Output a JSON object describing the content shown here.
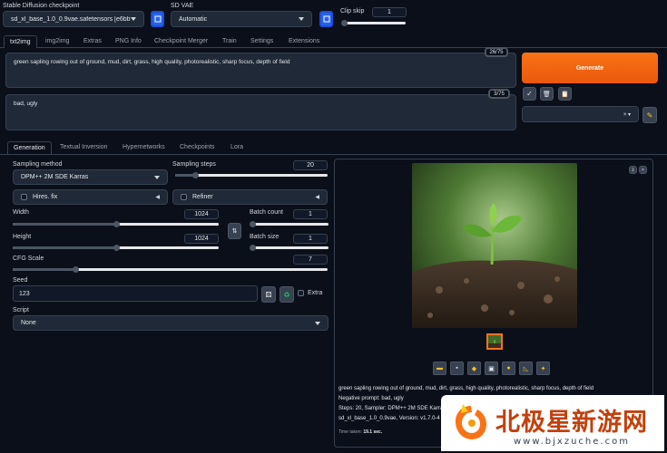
{
  "top": {
    "checkpoint_label": "Stable Diffusion checkpoint",
    "checkpoint_value": "sd_xl_base_1.0_0.9vae.safetensors [e6bb9ea85",
    "vae_label": "SD VAE",
    "vae_value": "Automatic",
    "clip_label": "Clip skip",
    "clip_value": "1"
  },
  "tabs": [
    "txt2img",
    "img2img",
    "Extras",
    "PNG Info",
    "Checkpoint Merger",
    "Train",
    "Settings",
    "Extensions"
  ],
  "prompt": {
    "positive": "green sapling rowing out of ground, mud, dirt, grass, high quality, photorealistic, sharp focus, depth of field",
    "positive_counter": "26/75",
    "negative": "bad, ugly",
    "negative_counter": "3/75",
    "generate_label": "Generate",
    "style_clear": "× ▾"
  },
  "subtabs": [
    "Generation",
    "Textual Inversion",
    "Hypernetworks",
    "Checkpoints",
    "Lora"
  ],
  "generation": {
    "sampling_method_label": "Sampling method",
    "sampling_method_value": "DPM++ 2M SDE Karras",
    "sampling_steps_label": "Sampling steps",
    "sampling_steps_value": "20",
    "sampling_steps_fraction": 0.13,
    "hires_label": "Hires. fix",
    "refiner_label": "Refiner",
    "width_label": "Width",
    "width_value": "1024",
    "width_fraction": 0.5,
    "height_label": "Height",
    "height_value": "1024",
    "height_fraction": 0.5,
    "batch_count_label": "Batch count",
    "batch_count_value": "1",
    "batch_size_label": "Batch size",
    "batch_size_value": "1",
    "cfg_label": "CFG Scale",
    "cfg_value": "7",
    "cfg_fraction": 0.2,
    "seed_label": "Seed",
    "seed_value": "123",
    "extra_label": "Extra",
    "script_label": "Script",
    "script_value": "None"
  },
  "output": {
    "info_prompt": "green sapling rowing out of ground, mud, dirt, grass, high quality, photorealistic, sharp focus, depth of field",
    "info_negative": "Negative prompt: bad, ugly",
    "info_steps": "Steps: 20, Sampler: DPM++ 2M SDE Karras",
    "info_model": "sd_xl_base_1.0_0.9vae, Version: v1.7.0-4",
    "time_label": "Time taken:",
    "time_value": "19.1 sec."
  },
  "watermark": {
    "title": "北极星新游网",
    "url": "www.bjxzuche.com"
  },
  "colors": {
    "background": "#0b0f19",
    "accent_orange": "#f97316",
    "accent_blue": "#2563eb"
  }
}
